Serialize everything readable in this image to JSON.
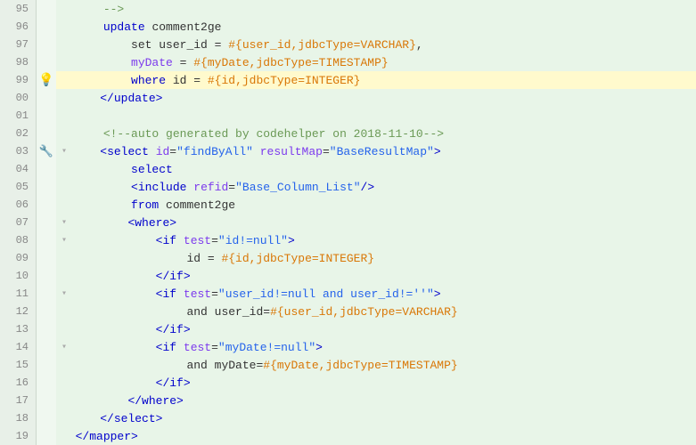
{
  "lines": [
    {
      "num": "95",
      "icon": "",
      "fold": "",
      "highlight": false,
      "tokens": [
        {
          "t": "    ",
          "c": ""
        },
        {
          "t": "-->",
          "c": "kw-comment"
        }
      ]
    },
    {
      "num": "96",
      "icon": "",
      "fold": "",
      "highlight": false,
      "tokens": [
        {
          "t": "    ",
          "c": ""
        },
        {
          "t": "update",
          "c": "kw-sql"
        },
        {
          "t": " comment2ge",
          "c": "kw-text"
        }
      ]
    },
    {
      "num": "97",
      "icon": "",
      "fold": "",
      "highlight": false,
      "tokens": [
        {
          "t": "        ",
          "c": ""
        },
        {
          "t": "set user_id = ",
          "c": "kw-text"
        },
        {
          "t": "#{user_id,jdbcType=VARCHAR}",
          "c": "kw-hash"
        },
        {
          "t": ",",
          "c": "kw-text"
        }
      ]
    },
    {
      "num": "98",
      "icon": "",
      "fold": "",
      "highlight": false,
      "tokens": [
        {
          "t": "        ",
          "c": ""
        },
        {
          "t": "myDate",
          "c": "kw-attr"
        },
        {
          "t": " = ",
          "c": "kw-text"
        },
        {
          "t": "#{myDate,jdbcType=TIMESTAMP}",
          "c": "kw-hash"
        }
      ]
    },
    {
      "num": "99",
      "icon": "bulb",
      "fold": "",
      "highlight": true,
      "tokens": [
        {
          "t": "        ",
          "c": ""
        },
        {
          "t": "where",
          "c": "kw-sql"
        },
        {
          "t": " id = ",
          "c": "kw-text"
        },
        {
          "t": "#{id,jdbcType=INTEGER}",
          "c": "kw-hash"
        }
      ]
    },
    {
      "num": "00",
      "icon": "",
      "fold": "close",
      "highlight": false,
      "tokens": [
        {
          "t": "    ",
          "c": ""
        },
        {
          "t": "</update>",
          "c": "kw-tag"
        }
      ]
    },
    {
      "num": "01",
      "icon": "",
      "fold": "",
      "highlight": false,
      "tokens": []
    },
    {
      "num": "02",
      "icon": "",
      "fold": "",
      "highlight": false,
      "tokens": [
        {
          "t": "    ",
          "c": ""
        },
        {
          "t": "<!--auto generated by codehelper on 2018-11-10-->",
          "c": "kw-comment"
        }
      ]
    },
    {
      "num": "03",
      "icon": "plugin",
      "fold": "open",
      "highlight": false,
      "tokens": [
        {
          "t": "    ",
          "c": ""
        },
        {
          "t": "<",
          "c": "kw-tag"
        },
        {
          "t": "select",
          "c": "kw-tag"
        },
        {
          "t": " ",
          "c": ""
        },
        {
          "t": "id",
          "c": "kw-attr"
        },
        {
          "t": "=",
          "c": "kw-text"
        },
        {
          "t": "\"findByAll\"",
          "c": "kw-val"
        },
        {
          "t": " ",
          "c": ""
        },
        {
          "t": "resultMap",
          "c": "kw-attr"
        },
        {
          "t": "=",
          "c": "kw-text"
        },
        {
          "t": "\"BaseResultMap\"",
          "c": "kw-val"
        },
        {
          "t": ">",
          "c": "kw-tag"
        }
      ]
    },
    {
      "num": "04",
      "icon": "",
      "fold": "",
      "highlight": false,
      "tokens": [
        {
          "t": "        ",
          "c": ""
        },
        {
          "t": "select",
          "c": "kw-sql"
        }
      ]
    },
    {
      "num": "05",
      "icon": "",
      "fold": "",
      "highlight": false,
      "tokens": [
        {
          "t": "        ",
          "c": ""
        },
        {
          "t": "<",
          "c": "kw-tag"
        },
        {
          "t": "include",
          "c": "kw-tag"
        },
        {
          "t": " ",
          "c": ""
        },
        {
          "t": "refid",
          "c": "kw-attr"
        },
        {
          "t": "=",
          "c": "kw-text"
        },
        {
          "t": "\"Base_Column_List\"",
          "c": "kw-val"
        },
        {
          "t": "/>",
          "c": "kw-tag"
        }
      ]
    },
    {
      "num": "06",
      "icon": "",
      "fold": "",
      "highlight": false,
      "tokens": [
        {
          "t": "        ",
          "c": ""
        },
        {
          "t": "from",
          "c": "kw-sql"
        },
        {
          "t": " comment2ge",
          "c": "kw-text"
        }
      ]
    },
    {
      "num": "07",
      "icon": "",
      "fold": "open",
      "highlight": false,
      "tokens": [
        {
          "t": "        ",
          "c": ""
        },
        {
          "t": "<where>",
          "c": "kw-tag"
        }
      ]
    },
    {
      "num": "08",
      "icon": "",
      "fold": "open",
      "highlight": false,
      "tokens": [
        {
          "t": "            ",
          "c": ""
        },
        {
          "t": "<",
          "c": "kw-tag"
        },
        {
          "t": "if",
          "c": "kw-tag"
        },
        {
          "t": " ",
          "c": ""
        },
        {
          "t": "test",
          "c": "kw-attr"
        },
        {
          "t": "=",
          "c": "kw-text"
        },
        {
          "t": "\"id!=null\"",
          "c": "kw-val"
        },
        {
          "t": ">",
          "c": "kw-tag"
        }
      ]
    },
    {
      "num": "09",
      "icon": "",
      "fold": "",
      "highlight": false,
      "tokens": [
        {
          "t": "                ",
          "c": ""
        },
        {
          "t": "id = ",
          "c": "kw-text"
        },
        {
          "t": "#{id,jdbcType=INTEGER}",
          "c": "kw-hash"
        }
      ]
    },
    {
      "num": "10",
      "icon": "",
      "fold": "close",
      "highlight": false,
      "tokens": [
        {
          "t": "            ",
          "c": ""
        },
        {
          "t": "</if>",
          "c": "kw-tag"
        }
      ]
    },
    {
      "num": "11",
      "icon": "",
      "fold": "open",
      "highlight": false,
      "tokens": [
        {
          "t": "            ",
          "c": ""
        },
        {
          "t": "<",
          "c": "kw-tag"
        },
        {
          "t": "if",
          "c": "kw-tag"
        },
        {
          "t": " ",
          "c": ""
        },
        {
          "t": "test",
          "c": "kw-attr"
        },
        {
          "t": "=",
          "c": "kw-text"
        },
        {
          "t": "\"user_id!=null and user_id!=''\"",
          "c": "kw-val"
        },
        {
          "t": ">",
          "c": "kw-tag"
        }
      ]
    },
    {
      "num": "12",
      "icon": "",
      "fold": "",
      "highlight": false,
      "tokens": [
        {
          "t": "                ",
          "c": ""
        },
        {
          "t": "and user_id=",
          "c": "kw-text"
        },
        {
          "t": "#{user_id,jdbcType=VARCHAR}",
          "c": "kw-hash"
        }
      ]
    },
    {
      "num": "13",
      "icon": "",
      "fold": "close",
      "highlight": false,
      "tokens": [
        {
          "t": "            ",
          "c": ""
        },
        {
          "t": "</if>",
          "c": "kw-tag"
        }
      ]
    },
    {
      "num": "14",
      "icon": "",
      "fold": "open",
      "highlight": false,
      "tokens": [
        {
          "t": "            ",
          "c": ""
        },
        {
          "t": "<",
          "c": "kw-tag"
        },
        {
          "t": "if",
          "c": "kw-tag"
        },
        {
          "t": " ",
          "c": ""
        },
        {
          "t": "test",
          "c": "kw-attr"
        },
        {
          "t": "=",
          "c": "kw-text"
        },
        {
          "t": "\"myDate!=null\"",
          "c": "kw-val"
        },
        {
          "t": ">",
          "c": "kw-tag"
        }
      ]
    },
    {
      "num": "15",
      "icon": "",
      "fold": "",
      "highlight": false,
      "tokens": [
        {
          "t": "                ",
          "c": ""
        },
        {
          "t": "and myDate=",
          "c": "kw-text"
        },
        {
          "t": "#{myDate,jdbcType=TIMESTAMP}",
          "c": "kw-hash"
        }
      ]
    },
    {
      "num": "16",
      "icon": "",
      "fold": "close",
      "highlight": false,
      "tokens": [
        {
          "t": "            ",
          "c": ""
        },
        {
          "t": "</if>",
          "c": "kw-tag"
        }
      ]
    },
    {
      "num": "17",
      "icon": "",
      "fold": "close",
      "highlight": false,
      "tokens": [
        {
          "t": "        ",
          "c": ""
        },
        {
          "t": "</where>",
          "c": "kw-tag"
        }
      ]
    },
    {
      "num": "18",
      "icon": "",
      "fold": "close",
      "highlight": false,
      "tokens": [
        {
          "t": "    ",
          "c": ""
        },
        {
          "t": "</select>",
          "c": "kw-tag"
        }
      ]
    },
    {
      "num": "19",
      "icon": "",
      "fold": "",
      "highlight": false,
      "tokens": [
        {
          "t": "</mapper>",
          "c": "kw-tag"
        }
      ]
    }
  ]
}
